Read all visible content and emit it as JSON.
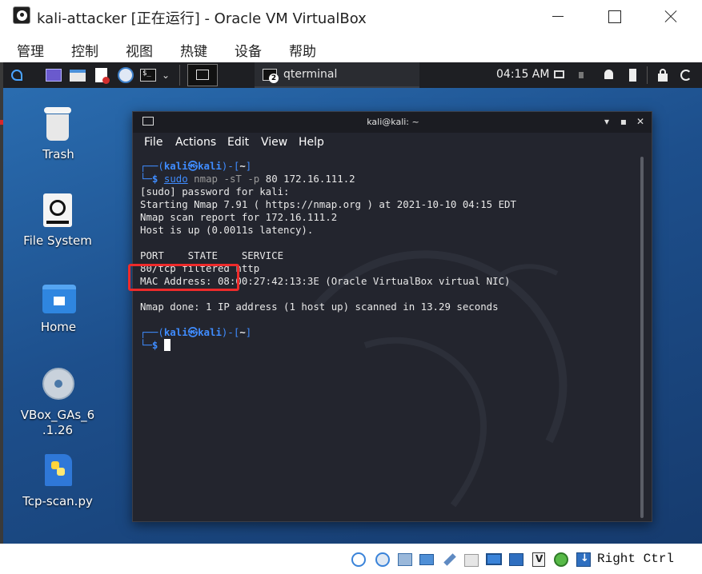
{
  "window": {
    "title": "kali-attacker [正在运行] - Oracle VM VirtualBox"
  },
  "vbox_menu": {
    "items": [
      {
        "label": "管理"
      },
      {
        "label": "控制"
      },
      {
        "label": "视图"
      },
      {
        "label": "热键"
      },
      {
        "label": "设备"
      },
      {
        "label": "帮助"
      }
    ]
  },
  "panel": {
    "task_label": "qterminal",
    "task_badge": "2",
    "clock": "04:15 AM"
  },
  "desktop": {
    "icons": [
      {
        "label": "Trash",
        "icon": "trash-icon"
      },
      {
        "label": "File System",
        "icon": "drive-icon"
      },
      {
        "label": "Home",
        "icon": "home-folder-icon"
      },
      {
        "label": "VBox_GAs_6",
        "label2": ".1.26",
        "icon": "cd-icon"
      },
      {
        "label": "Tcp-scan.py",
        "icon": "python-file-icon"
      }
    ]
  },
  "terminal": {
    "title": "kali@kali: ~",
    "menu": [
      {
        "label": "File"
      },
      {
        "label": "Actions"
      },
      {
        "label": "Edit"
      },
      {
        "label": "View"
      },
      {
        "label": "Help"
      }
    ],
    "prompt_open": "┌──(",
    "prompt_user": "kali",
    "prompt_at": "㉿",
    "prompt_host": "kali",
    "prompt_close": ")-[",
    "prompt_dir": "~",
    "prompt_end": "]",
    "prompt_line2": "└─",
    "prompt_dollar": "$",
    "cmd_sudo": "sudo",
    "cmd_nmap": "nmap",
    "cmd_flag_st": "-sT",
    "cmd_flag_p": "-p",
    "cmd_port": "80",
    "cmd_target": "172.16.111.2",
    "output": [
      "[sudo] password for kali:",
      "Starting Nmap 7.91 ( https://nmap.org ) at 2021-10-10 04:15 EDT",
      "Nmap scan report for 172.16.111.2",
      "Host is up (0.0011s latency).",
      "",
      "PORT    STATE    SERVICE",
      "80/tcp filtered http",
      "MAC Address: 08:00:27:42:13:3E (Oracle VirtualBox virtual NIC)",
      "",
      "Nmap done: 1 IP address (1 host up) scanned in 13.29 seconds"
    ]
  },
  "statusbar": {
    "host_key": "Right Ctrl"
  },
  "colors": {
    "highlight": "#ee2b2b",
    "prompt_blue": "#3f8cff",
    "terminal_bg": "#23252e"
  }
}
